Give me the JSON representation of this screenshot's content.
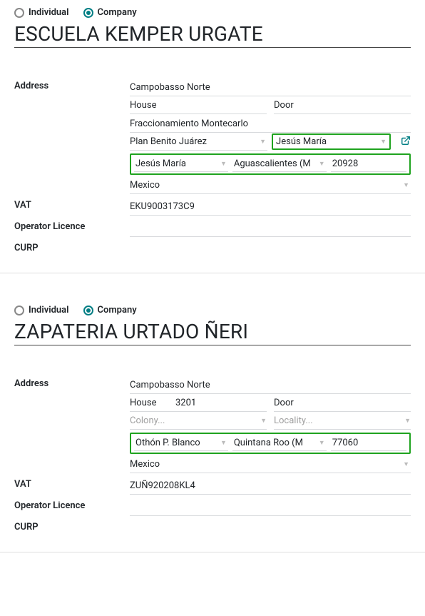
{
  "records": [
    {
      "contactType": {
        "individual_label": "Individual",
        "company_label": "Company",
        "selected": "company"
      },
      "name": "ESCUELA KEMPER URGATE",
      "labels": {
        "address": "Address",
        "vat": "VAT",
        "operator_licence": "Operator Licence",
        "curp": "CURP",
        "house": "House",
        "door": "Door"
      },
      "placeholders": {
        "colony": "Colony...",
        "locality": "Locality..."
      },
      "address": {
        "street": "Campobasso Norte",
        "house": "",
        "door": "",
        "colony": "Fraccionamiento Montecarlo",
        "locality_line1_left": "Plan Benito Juárez",
        "locality_line1_right": "Jesús María",
        "city": "Jesús María",
        "state": "Aguascalientes (MX)",
        "state_display": "Aguascalientes (M",
        "zip": "20928",
        "country": "Mexico"
      },
      "vat": "EKU9003173C9",
      "operator_licence": "",
      "curp": ""
    },
    {
      "contactType": {
        "individual_label": "Individual",
        "company_label": "Company",
        "selected": "company"
      },
      "name": "ZAPATERIA URTADO ÑERI",
      "labels": {
        "address": "Address",
        "vat": "VAT",
        "operator_licence": "Operator Licence",
        "curp": "CURP",
        "house": "House",
        "door": "Door"
      },
      "placeholders": {
        "colony": "Colony...",
        "locality": "Locality..."
      },
      "address": {
        "street": "Campobasso Norte",
        "house": "3201",
        "door": "",
        "colony": "",
        "locality": "",
        "city": "Othón P. Blanco",
        "state": "Quintana Roo (MX)",
        "state_display": "Quintana Roo (M",
        "zip": "77060",
        "country": "Mexico"
      },
      "vat": "ZUÑ920208KL4",
      "operator_licence": "",
      "curp": ""
    }
  ]
}
